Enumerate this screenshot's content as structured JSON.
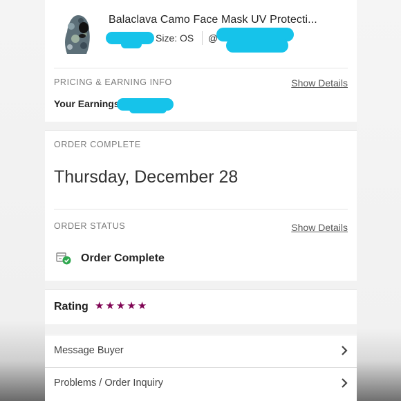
{
  "product": {
    "title": "Balaclava Camo Face Mask UV Protecti...",
    "size": "Size: OS",
    "seller_prefix": "@"
  },
  "pricing": {
    "label": "PRICING & EARNING INFO",
    "show_details": "Show Details",
    "earnings_label": "Your Earnings"
  },
  "order_complete": {
    "label": "ORDER COMPLETE",
    "date": "Thursday, December 28"
  },
  "order_status": {
    "label": "ORDER STATUS",
    "show_details": "Show Details",
    "status": "Order Complete",
    "status_color": "#2fa84f"
  },
  "rating": {
    "label": "Rating",
    "stars": 5,
    "max_stars": 5,
    "star_color": "#7f0353"
  },
  "actions": [
    {
      "label": "Message Buyer"
    },
    {
      "label": "Problems / Order Inquiry"
    }
  ],
  "redaction_color": "#16c3ea"
}
